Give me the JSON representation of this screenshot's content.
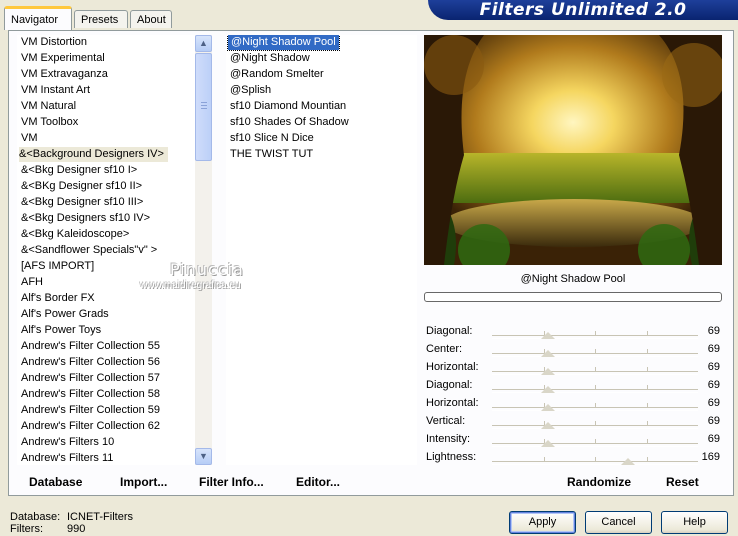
{
  "tabs": [
    {
      "label": "Navigator",
      "active": true
    },
    {
      "label": "Presets",
      "active": false
    },
    {
      "label": "About",
      "active": false
    }
  ],
  "title": "Filters Unlimited 2.0",
  "categories": [
    "VM Distortion",
    "VM Experimental",
    "VM Extravaganza",
    "VM Instant Art",
    "VM Natural",
    "VM Toolbox",
    "VM",
    "&<Background Designers IV>",
    "&<Bkg Designer sf10 I>",
    "&<BKg Designer sf10 II>",
    "&<Bkg Designer sf10 III>",
    "&<Bkg Designers sf10 IV>",
    "&<Bkg Kaleidoscope>",
    "&<Sandflower Specials\"v\" >",
    "[AFS IMPORT]",
    "AFH",
    "Alf's Border FX",
    "Alf's Power Grads",
    "Alf's Power Toys",
    "Andrew's Filter Collection 55",
    "Andrew's Filter Collection 56",
    "Andrew's Filter Collection 57",
    "Andrew's Filter Collection 58",
    "Andrew's Filter Collection 59",
    "Andrew's Filter Collection 62",
    "Andrew's Filters 10",
    "Andrew's Filters 11"
  ],
  "selected_category_index": 7,
  "filters": [
    "@Night Shadow Pool",
    "@Night Shadow",
    "@Random Smelter",
    "@Splish",
    "sf10 Diamond Mountian",
    "sf10 Shades Of Shadow",
    "sf10 Slice N Dice",
    "THE TWIST TUT"
  ],
  "selected_filter_index": 0,
  "preview_filter_name": "@Night Shadow Pool",
  "params": [
    {
      "label": "Diagonal:",
      "value": "69",
      "fraction": 0.27
    },
    {
      "label": "Center:",
      "value": "69",
      "fraction": 0.27
    },
    {
      "label": "Horizontal:",
      "value": "69",
      "fraction": 0.27
    },
    {
      "label": "Diagonal:",
      "value": "69",
      "fraction": 0.27
    },
    {
      "label": "Horizontal:",
      "value": "69",
      "fraction": 0.27
    },
    {
      "label": "Vertical:",
      "value": "69",
      "fraction": 0.27
    },
    {
      "label": "Intensity:",
      "value": "69",
      "fraction": 0.27
    },
    {
      "label": "Lightness:",
      "value": "169",
      "fraction": 0.66
    }
  ],
  "panel_buttons": {
    "database": "Database",
    "import": "Import...",
    "filter_info": "Filter Info...",
    "editor": "Editor...",
    "randomize": "Randomize",
    "reset": "Reset"
  },
  "status": {
    "database_label": "Database:",
    "database_value": "ICNET-Filters",
    "filters_label": "Filters:",
    "filters_value": "990"
  },
  "dialog_buttons": {
    "apply": "Apply",
    "cancel": "Cancel",
    "help": "Help"
  },
  "watermark": {
    "name": "Pinuccia",
    "url": "www.maidiregrafica.eu"
  },
  "icons": {
    "scroll_up": "arrow-up-icon",
    "scroll_down": "arrow-down-icon",
    "thumb_grip": "grip-icon"
  }
}
